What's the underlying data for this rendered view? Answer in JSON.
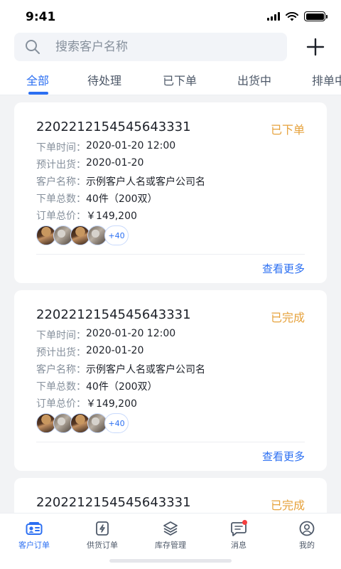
{
  "status_bar": {
    "time": "9:41"
  },
  "search": {
    "placeholder": "搜索客户名称"
  },
  "tabs": [
    {
      "label": "全部",
      "active": true
    },
    {
      "label": "待处理"
    },
    {
      "label": "已下单"
    },
    {
      "label": "出货中"
    },
    {
      "label": "排单中"
    }
  ],
  "orders": [
    {
      "order_no": "2202212154545643331",
      "status": "已下单",
      "fields": [
        {
          "label": "下单时间：",
          "value": "2020-01-20  12:00"
        },
        {
          "label": "预计出货：",
          "value": "2020-01-20"
        },
        {
          "label": "客户名称：",
          "value": "示例客户人名或客户公司名"
        },
        {
          "label": "下单总数：",
          "value": "40件（200双）"
        },
        {
          "label": "订单总价：",
          "value": "￥149,200"
        }
      ],
      "extra_count": "+40",
      "more_label": "查看更多"
    },
    {
      "order_no": "2202212154545643331",
      "status": "已完成",
      "fields": [
        {
          "label": "下单时间：",
          "value": "2020-01-20  12:00"
        },
        {
          "label": "预计出货：",
          "value": "2020-01-20"
        },
        {
          "label": "客户名称：",
          "value": "示例客户人名或客户公司名"
        },
        {
          "label": "下单总数：",
          "value": "40件（200双）"
        },
        {
          "label": "订单总价：",
          "value": "￥149,200"
        }
      ],
      "extra_count": "+40",
      "more_label": "查看更多"
    },
    {
      "order_no": "2202212154545643331",
      "status": "已完成"
    }
  ],
  "tabbar": [
    {
      "label": "客户订单",
      "icon": "customer-order-icon",
      "active": true
    },
    {
      "label": "供货订单",
      "icon": "supply-order-icon"
    },
    {
      "label": "库存管理",
      "icon": "inventory-icon"
    },
    {
      "label": "消息",
      "icon": "message-icon",
      "badge": true
    },
    {
      "label": "我的",
      "icon": "profile-icon"
    }
  ],
  "colors": {
    "accent": "#2b6ff2",
    "status": "#e6a23c",
    "badge": "#f53f3f"
  }
}
